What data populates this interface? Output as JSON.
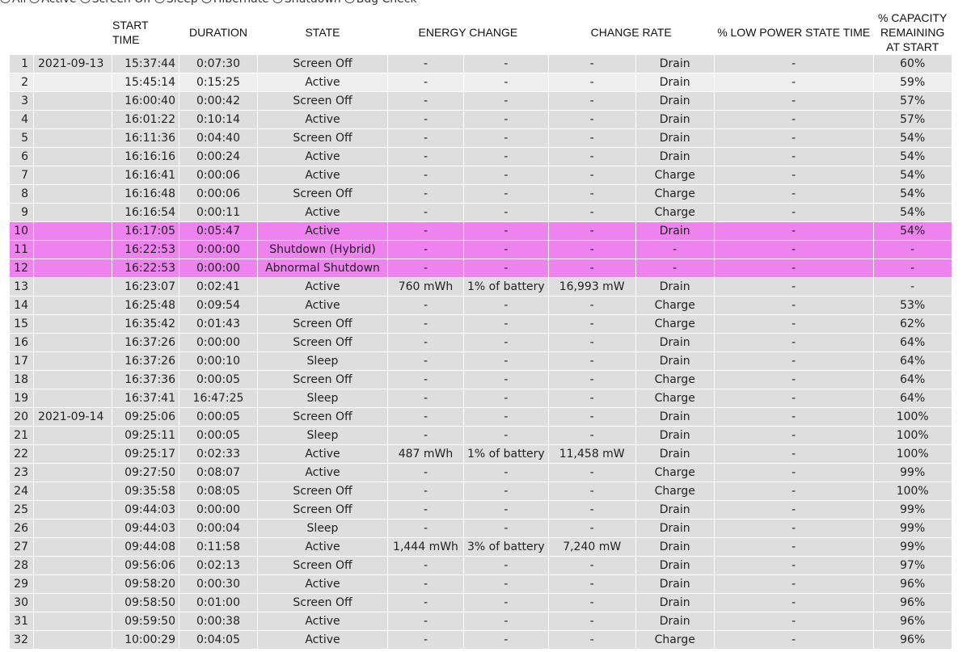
{
  "filters": [
    {
      "label": "All",
      "checked": true
    },
    {
      "label": "Active",
      "checked": false
    },
    {
      "label": "Screen Off",
      "checked": false
    },
    {
      "label": "Sleep",
      "checked": false
    },
    {
      "label": "Hibernate",
      "checked": false
    },
    {
      "label": "Shutdown",
      "checked": false
    },
    {
      "label": "Bug Check",
      "checked": false
    }
  ],
  "headers": {
    "index": "",
    "start_date": "",
    "start_time": "START TIME",
    "duration": "DURATION",
    "state": "STATE",
    "energy_change": "ENERGY CHANGE",
    "change_rate": "CHANGE RATE",
    "low_power": "% LOW POWER STATE TIME",
    "capacity": "% CAPACITY REMAINING AT START"
  },
  "colors": {
    "row": "#dedede",
    "row_alt": "#eeeeee",
    "highlight": "#ee82ee"
  },
  "rows": [
    {
      "n": "1",
      "date": "2021-09-13",
      "time": "15:37:44",
      "dur": "0:07:30",
      "state": "Screen Off",
      "energy": "-",
      "pct": "-",
      "rate": "-",
      "dir": "Drain",
      "low": "-",
      "cap": "60%",
      "style": "normal"
    },
    {
      "n": "2",
      "date": "",
      "time": "15:45:14",
      "dur": "0:15:25",
      "state": "Active",
      "energy": "-",
      "pct": "-",
      "rate": "-",
      "dir": "Drain",
      "low": "-",
      "cap": "59%",
      "style": "alt"
    },
    {
      "n": "3",
      "date": "",
      "time": "16:00:40",
      "dur": "0:00:42",
      "state": "Screen Off",
      "energy": "-",
      "pct": "-",
      "rate": "-",
      "dir": "Drain",
      "low": "-",
      "cap": "57%",
      "style": "normal"
    },
    {
      "n": "4",
      "date": "",
      "time": "16:01:22",
      "dur": "0:10:14",
      "state": "Active",
      "energy": "-",
      "pct": "-",
      "rate": "-",
      "dir": "Drain",
      "low": "-",
      "cap": "57%",
      "style": "normal"
    },
    {
      "n": "5",
      "date": "",
      "time": "16:11:36",
      "dur": "0:04:40",
      "state": "Screen Off",
      "energy": "-",
      "pct": "-",
      "rate": "-",
      "dir": "Drain",
      "low": "-",
      "cap": "54%",
      "style": "normal"
    },
    {
      "n": "6",
      "date": "",
      "time": "16:16:16",
      "dur": "0:00:24",
      "state": "Active",
      "energy": "-",
      "pct": "-",
      "rate": "-",
      "dir": "Drain",
      "low": "-",
      "cap": "54%",
      "style": "normal"
    },
    {
      "n": "7",
      "date": "",
      "time": "16:16:41",
      "dur": "0:00:06",
      "state": "Active",
      "energy": "-",
      "pct": "-",
      "rate": "-",
      "dir": "Charge",
      "low": "-",
      "cap": "54%",
      "style": "normal"
    },
    {
      "n": "8",
      "date": "",
      "time": "16:16:48",
      "dur": "0:00:06",
      "state": "Screen Off",
      "energy": "-",
      "pct": "-",
      "rate": "-",
      "dir": "Charge",
      "low": "-",
      "cap": "54%",
      "style": "normal"
    },
    {
      "n": "9",
      "date": "",
      "time": "16:16:54",
      "dur": "0:00:11",
      "state": "Active",
      "energy": "-",
      "pct": "-",
      "rate": "-",
      "dir": "Charge",
      "low": "-",
      "cap": "54%",
      "style": "normal"
    },
    {
      "n": "10",
      "date": "",
      "time": "16:17:05",
      "dur": "0:05:47",
      "state": "Active",
      "energy": "-",
      "pct": "-",
      "rate": "-",
      "dir": "Drain",
      "low": "-",
      "cap": "54%",
      "style": "hl"
    },
    {
      "n": "11",
      "date": "",
      "time": "16:22:53",
      "dur": "0:00:00",
      "state": "Shutdown (Hybrid)",
      "energy": "-",
      "pct": "-",
      "rate": "-",
      "dir": "-",
      "low": "-",
      "cap": "-",
      "style": "hl"
    },
    {
      "n": "12",
      "date": "",
      "time": "16:22:53",
      "dur": "0:00:00",
      "state": "Abnormal Shutdown",
      "energy": "-",
      "pct": "-",
      "rate": "-",
      "dir": "-",
      "low": "-",
      "cap": "-",
      "style": "hl"
    },
    {
      "n": "13",
      "date": "",
      "time": "16:23:07",
      "dur": "0:02:41",
      "state": "Active",
      "energy": "760 mWh",
      "pct": "1% of battery",
      "rate": "16,993 mW",
      "dir": "Drain",
      "low": "-",
      "cap": "-",
      "style": "normal"
    },
    {
      "n": "14",
      "date": "",
      "time": "16:25:48",
      "dur": "0:09:54",
      "state": "Active",
      "energy": "-",
      "pct": "-",
      "rate": "-",
      "dir": "Charge",
      "low": "-",
      "cap": "53%",
      "style": "normal"
    },
    {
      "n": "15",
      "date": "",
      "time": "16:35:42",
      "dur": "0:01:43",
      "state": "Screen Off",
      "energy": "-",
      "pct": "-",
      "rate": "-",
      "dir": "Charge",
      "low": "-",
      "cap": "62%",
      "style": "normal"
    },
    {
      "n": "16",
      "date": "",
      "time": "16:37:26",
      "dur": "0:00:00",
      "state": "Screen Off",
      "energy": "-",
      "pct": "-",
      "rate": "-",
      "dir": "Drain",
      "low": "-",
      "cap": "64%",
      "style": "normal"
    },
    {
      "n": "17",
      "date": "",
      "time": "16:37:26",
      "dur": "0:00:10",
      "state": "Sleep",
      "energy": "-",
      "pct": "-",
      "rate": "-",
      "dir": "Drain",
      "low": "-",
      "cap": "64%",
      "style": "normal"
    },
    {
      "n": "18",
      "date": "",
      "time": "16:37:36",
      "dur": "0:00:05",
      "state": "Screen Off",
      "energy": "-",
      "pct": "-",
      "rate": "-",
      "dir": "Charge",
      "low": "-",
      "cap": "64%",
      "style": "normal"
    },
    {
      "n": "19",
      "date": "",
      "time": "16:37:41",
      "dur": "16:47:25",
      "state": "Sleep",
      "energy": "-",
      "pct": "-",
      "rate": "-",
      "dir": "Charge",
      "low": "-",
      "cap": "64%",
      "style": "normal"
    },
    {
      "n": "20",
      "date": "2021-09-14",
      "time": "09:25:06",
      "dur": "0:00:05",
      "state": "Screen Off",
      "energy": "-",
      "pct": "-",
      "rate": "-",
      "dir": "Drain",
      "low": "-",
      "cap": "100%",
      "style": "normal"
    },
    {
      "n": "21",
      "date": "",
      "time": "09:25:11",
      "dur": "0:00:05",
      "state": "Sleep",
      "energy": "-",
      "pct": "-",
      "rate": "-",
      "dir": "Drain",
      "low": "-",
      "cap": "100%",
      "style": "normal"
    },
    {
      "n": "22",
      "date": "",
      "time": "09:25:17",
      "dur": "0:02:33",
      "state": "Active",
      "energy": "487 mWh",
      "pct": "1% of battery",
      "rate": "11,458 mW",
      "dir": "Drain",
      "low": "-",
      "cap": "100%",
      "style": "normal"
    },
    {
      "n": "23",
      "date": "",
      "time": "09:27:50",
      "dur": "0:08:07",
      "state": "Active",
      "energy": "-",
      "pct": "-",
      "rate": "-",
      "dir": "Charge",
      "low": "-",
      "cap": "99%",
      "style": "normal"
    },
    {
      "n": "24",
      "date": "",
      "time": "09:35:58",
      "dur": "0:08:05",
      "state": "Screen Off",
      "energy": "-",
      "pct": "-",
      "rate": "-",
      "dir": "Charge",
      "low": "-",
      "cap": "100%",
      "style": "normal"
    },
    {
      "n": "25",
      "date": "",
      "time": "09:44:03",
      "dur": "0:00:00",
      "state": "Screen Off",
      "energy": "-",
      "pct": "-",
      "rate": "-",
      "dir": "Drain",
      "low": "-",
      "cap": "99%",
      "style": "normal"
    },
    {
      "n": "26",
      "date": "",
      "time": "09:44:03",
      "dur": "0:00:04",
      "state": "Sleep",
      "energy": "-",
      "pct": "-",
      "rate": "-",
      "dir": "Drain",
      "low": "-",
      "cap": "99%",
      "style": "normal"
    },
    {
      "n": "27",
      "date": "",
      "time": "09:44:08",
      "dur": "0:11:58",
      "state": "Active",
      "energy": "1,444 mWh",
      "pct": "3% of battery",
      "rate": "7,240 mW",
      "dir": "Drain",
      "low": "-",
      "cap": "99%",
      "style": "normal"
    },
    {
      "n": "28",
      "date": "",
      "time": "09:56:06",
      "dur": "0:02:13",
      "state": "Screen Off",
      "energy": "-",
      "pct": "-",
      "rate": "-",
      "dir": "Drain",
      "low": "-",
      "cap": "97%",
      "style": "normal"
    },
    {
      "n": "29",
      "date": "",
      "time": "09:58:20",
      "dur": "0:00:30",
      "state": "Active",
      "energy": "-",
      "pct": "-",
      "rate": "-",
      "dir": "Drain",
      "low": "-",
      "cap": "96%",
      "style": "normal"
    },
    {
      "n": "30",
      "date": "",
      "time": "09:58:50",
      "dur": "0:01:00",
      "state": "Screen Off",
      "energy": "-",
      "pct": "-",
      "rate": "-",
      "dir": "Drain",
      "low": "-",
      "cap": "96%",
      "style": "normal"
    },
    {
      "n": "31",
      "date": "",
      "time": "09:59:50",
      "dur": "0:00:38",
      "state": "Active",
      "energy": "-",
      "pct": "-",
      "rate": "-",
      "dir": "Drain",
      "low": "-",
      "cap": "96%",
      "style": "normal"
    },
    {
      "n": "32",
      "date": "",
      "time": "10:00:29",
      "dur": "0:04:05",
      "state": "Active",
      "energy": "-",
      "pct": "-",
      "rate": "-",
      "dir": "Charge",
      "low": "-",
      "cap": "96%",
      "style": "normal"
    }
  ]
}
